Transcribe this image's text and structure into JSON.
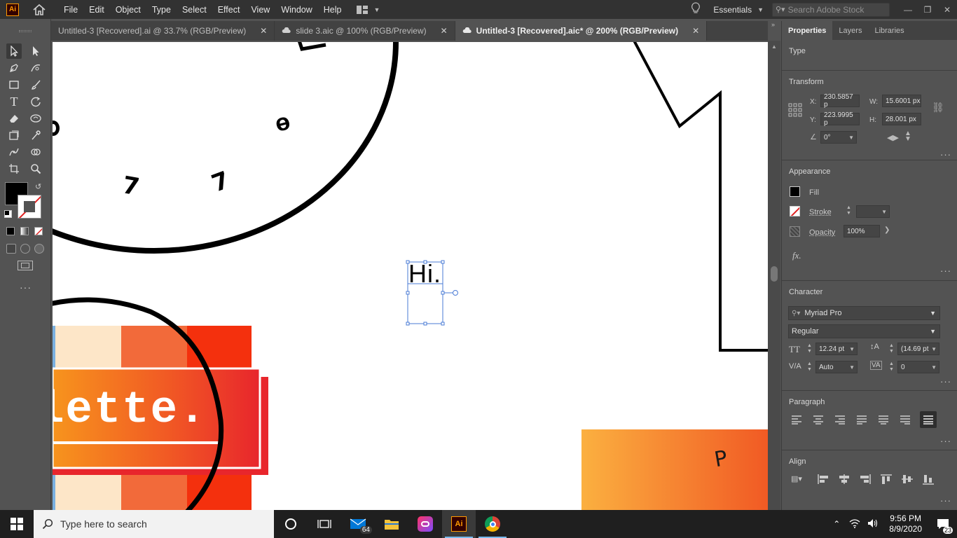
{
  "app": {
    "logo": "Ai"
  },
  "menu": [
    "File",
    "Edit",
    "Object",
    "Type",
    "Select",
    "Effect",
    "View",
    "Window",
    "Help"
  ],
  "workspace": "Essentials",
  "search_stock": {
    "placeholder": "Search Adobe Stock"
  },
  "tabs": [
    {
      "label": "Untitled-3 [Recovered].ai @ 33.7% (RGB/Preview)",
      "cloud": false,
      "active": false
    },
    {
      "label": "slide 3.aic @ 100% (RGB/Preview)",
      "cloud": true,
      "active": false
    },
    {
      "label": "Untitled-3 [Recovered].aic* @ 200% (RGB/Preview)",
      "cloud": true,
      "active": true
    }
  ],
  "canvas": {
    "selected_text": "Hi.",
    "banner_text": "lette.",
    "letter_p": "P",
    "glyph_a": "ɵ",
    "glyph_b": "7",
    "glyph_c": "7"
  },
  "panel": {
    "tabs": [
      "Properties",
      "Layers",
      "Libraries"
    ],
    "type_label": "Type",
    "transform": {
      "title": "Transform",
      "x_label": "X:",
      "x": "230.5857 p",
      "y_label": "Y:",
      "y": "223.9995 p",
      "w_label": "W:",
      "w": "15.6001 px",
      "h_label": "H:",
      "h": "28.001 px",
      "angle": "0°"
    },
    "appearance": {
      "title": "Appearance",
      "fill": "Fill",
      "stroke": "Stroke",
      "opacity": "Opacity",
      "opacity_value": "100%",
      "fx": "fx."
    },
    "character": {
      "title": "Character",
      "font": "Myriad Pro",
      "style": "Regular",
      "size": "12.24 pt",
      "leading": "(14.69 pt",
      "kerning": "Auto",
      "tracking": "0"
    },
    "paragraph": {
      "title": "Paragraph"
    },
    "align": {
      "title": "Align"
    }
  },
  "taskbar": {
    "search_placeholder": "Type here to search",
    "mail_badge": "64",
    "time": "9:56 PM",
    "date": "8/9/2020",
    "notif_count": "23"
  },
  "colors": {
    "accent_orange": "#ff9a00",
    "gradient_start": "#fbb040",
    "gradient_end": "#f15a24",
    "red": "#ee2a24",
    "cream": "#fde6c8"
  }
}
